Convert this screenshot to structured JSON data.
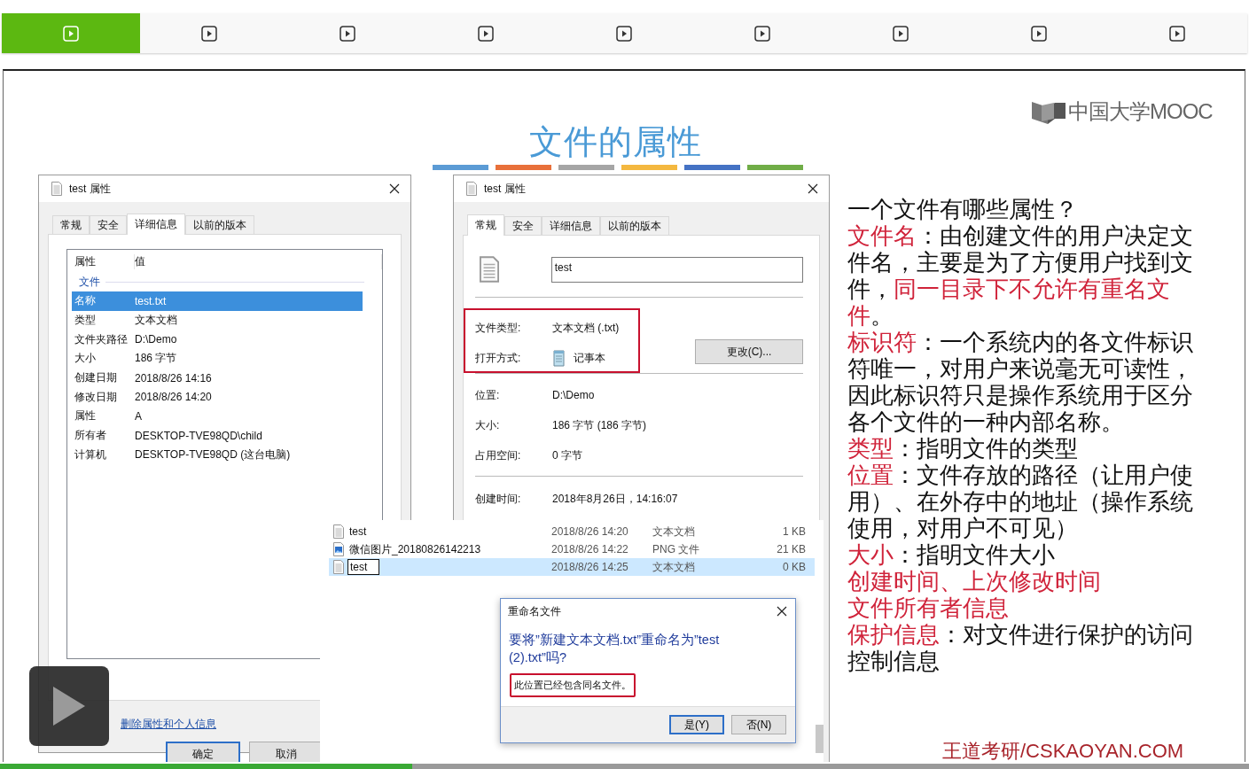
{
  "player_tabs": [
    {
      "selected": true
    },
    {
      "selected": false
    },
    {
      "selected": false
    },
    {
      "selected": false
    },
    {
      "selected": false
    },
    {
      "selected": false
    },
    {
      "selected": false
    },
    {
      "selected": false
    },
    {
      "selected": false
    }
  ],
  "slide": {
    "title": "文件的属性",
    "logo": "中国大学MOOC",
    "footer": "王道考研/CSKAOYAN.COM",
    "details_dialog": {
      "title": "test 属性",
      "tabs": [
        {
          "label": "常规",
          "selected": false
        },
        {
          "label": "安全",
          "selected": false
        },
        {
          "label": "详细信息",
          "selected": true
        },
        {
          "label": "以前的版本",
          "selected": false
        }
      ],
      "columns": [
        "属性",
        "值"
      ],
      "group": "文件",
      "rows": [
        {
          "property": "名称",
          "value": "test.txt",
          "selected": true
        },
        {
          "property": "类型",
          "value": "文本文档",
          "selected": false
        },
        {
          "property": "文件夹路径",
          "value": "D:\\Demo",
          "selected": false
        },
        {
          "property": "大小",
          "value": "186 字节",
          "selected": false
        },
        {
          "property": "创建日期",
          "value": "2018/8/26 14:16",
          "selected": false
        },
        {
          "property": "修改日期",
          "value": "2018/8/26 14:20",
          "selected": false
        },
        {
          "property": "属性",
          "value": "A",
          "selected": false
        },
        {
          "property": "所有者",
          "value": "DESKTOP-TVE98QD\\child",
          "selected": false
        },
        {
          "property": "计算机",
          "value": "DESKTOP-TVE98QD (这台电脑)",
          "selected": false
        }
      ],
      "link": "删除属性和个人信息",
      "buttons": [
        {
          "label": "确定",
          "default": true
        },
        {
          "label": "取消",
          "default": false
        }
      ]
    },
    "general_dialog": {
      "title": "test 属性",
      "tabs": [
        {
          "label": "常规",
          "selected": true
        },
        {
          "label": "安全",
          "selected": false
        },
        {
          "label": "详细信息",
          "selected": false
        },
        {
          "label": "以前的版本",
          "selected": false
        }
      ],
      "name": "test",
      "highlighted_fields": [
        {
          "label": "文件类型:",
          "value": "文本文档 (.txt)",
          "kind": "text"
        },
        {
          "label": "打开方式:",
          "value": "记事本",
          "kind": "app"
        }
      ],
      "change_button": "更改(C)...",
      "info": [
        {
          "label": "位置:",
          "value": "D:\\Demo"
        },
        {
          "label": "大小:",
          "value": "186 字节 (186 字节)"
        },
        {
          "label": "占用空间:",
          "value": "0 字节"
        }
      ],
      "created": {
        "label": "创建时间:",
        "value": "2018年8月26日，14:16:07"
      }
    },
    "explorer": {
      "files": [
        {
          "name": "test",
          "kind": "text",
          "modified": "2018/8/26 14:20",
          "type": "文本文档",
          "size": "1 KB",
          "selected": false,
          "editing": false
        },
        {
          "name": "微信图片_20180826142213",
          "kind": "image",
          "modified": "2018/8/26 14:22",
          "type": "PNG 文件",
          "size": "21 KB",
          "selected": false,
          "editing": false
        },
        {
          "name": "test",
          "kind": "text",
          "modified": "2018/8/26 14:25",
          "type": "文本文档",
          "size": "0 KB",
          "selected": true,
          "editing": true
        }
      ]
    },
    "rename_dialog": {
      "title": "重命名文件",
      "question": "要将”新建文本文档.txt”重命名为”test (2).txt”吗?",
      "warning": "此位置已经包含同名文件。",
      "buttons": [
        {
          "label": "是(Y)",
          "default": true
        },
        {
          "label": "否(N)",
          "default": false
        }
      ]
    },
    "notes": [
      {
        "segments": [
          {
            "text": "一个文件有哪些属性？",
            "highlight": false
          }
        ]
      },
      {
        "segments": [
          {
            "text": "文件名",
            "highlight": true
          },
          {
            "text": "：由创建文件的用户决定文件名，主要是为了方便用户找到文件，",
            "highlight": false
          },
          {
            "text": "同一目录下不允许有重名文件",
            "highlight": true
          },
          {
            "text": "。",
            "highlight": false
          }
        ]
      },
      {
        "segments": [
          {
            "text": "标识符",
            "highlight": true
          },
          {
            "text": "：一个系统内的各文件标识符唯一，对用户来说毫无可读性，因此标识符只是操作系统用于区分各个文件的一种内部名称。",
            "highlight": false
          }
        ]
      },
      {
        "segments": [
          {
            "text": "类型",
            "highlight": true
          },
          {
            "text": "：指明文件的类型",
            "highlight": false
          }
        ]
      },
      {
        "segments": [
          {
            "text": "位置",
            "highlight": true
          },
          {
            "text": "：文件存放的路径（让用户使用）、在外存中的地址（操作系统使用，对用户不可见）",
            "highlight": false
          }
        ]
      },
      {
        "segments": [
          {
            "text": "大小",
            "highlight": true
          },
          {
            "text": "：指明文件大小",
            "highlight": false
          }
        ]
      },
      {
        "segments": [
          {
            "text": "创建时间、上次修改时间",
            "highlight": true
          }
        ]
      },
      {
        "segments": [
          {
            "text": "文件所有者信息",
            "highlight": true
          }
        ]
      },
      {
        "segments": [
          {
            "text": "保护信息",
            "highlight": true
          },
          {
            "text": "：对文件进行保护的访问控制信息",
            "highlight": false
          }
        ]
      }
    ]
  },
  "video_progress": {
    "level": 0.33
  }
}
